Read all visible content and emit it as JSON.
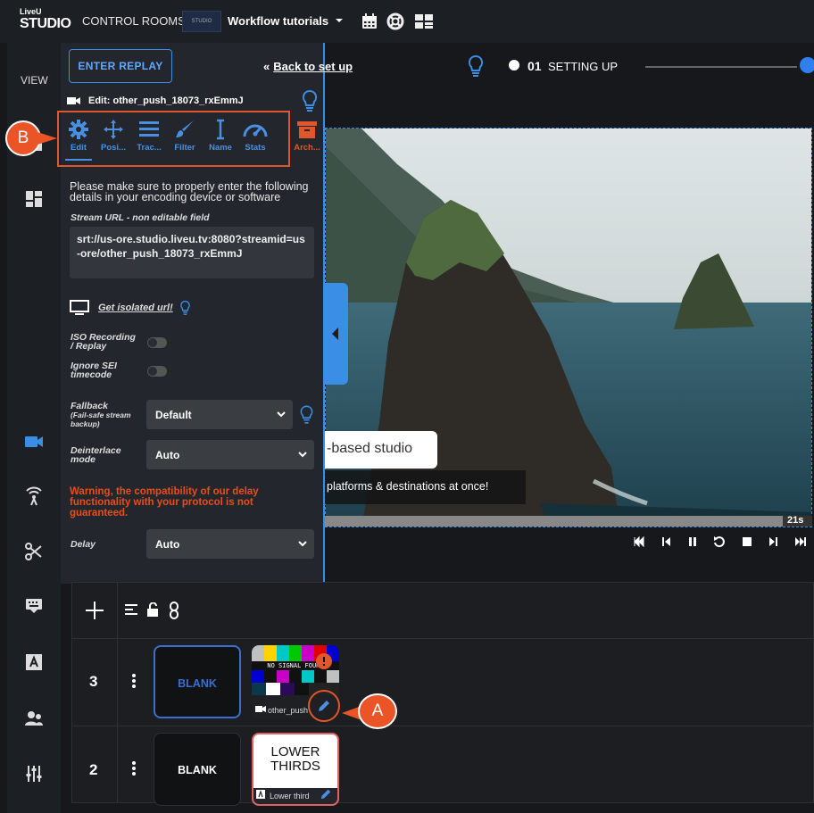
{
  "app": {
    "logo_line1": "LiveU",
    "logo_line2": "STUDIO",
    "nav_control_rooms": "CONTROL ROOMS",
    "room_thumb": "STUDIO",
    "workflow_title": "Workflow tutorials"
  },
  "sidebar": {
    "view_label": "VIEW"
  },
  "panel": {
    "enter_replay": "ENTER REPLAY",
    "edit_header": "Edit: other_push_18073_rxEmmJ",
    "tools": [
      {
        "label": "Edit",
        "icon": "gear-icon"
      },
      {
        "label": "Posi...",
        "icon": "move-icon"
      },
      {
        "label": "Trac...",
        "icon": "tracks-icon"
      },
      {
        "label": "Filter",
        "icon": "brush-icon"
      },
      {
        "label": "Name",
        "icon": "text-cursor-icon"
      },
      {
        "label": "Stats",
        "icon": "gauge-icon"
      },
      {
        "label": "Arch...",
        "icon": "archive-icon"
      }
    ],
    "info_text": "Please make sure to properly enter the following details in your encoding device or software",
    "stream_label": "Stream URL - non editable field",
    "stream_url": "srt://us-ore.studio.liveu.tv:8080?streamid=us-ore/other_push_18073_rxEmmJ",
    "isolated_url": "Get isolated url!",
    "iso_label_1": "ISO Recording",
    "iso_label_2": "/ Replay",
    "iso_enabled": false,
    "sei_label_1": "Ignore SEI",
    "sei_label_2": "timecode",
    "sei_enabled": false,
    "fallback_label": "Fallback",
    "fallback_sub_1": "(Fail-safe stream",
    "fallback_sub_2": "backup)",
    "fallback_value": "Default",
    "deinterlace_label_1": "Deinterlace",
    "deinterlace_label_2": "mode",
    "deinterlace_value": "Auto",
    "warning": "Warning, the compatibility of our delay functionality with your protocol is not guaranteed.",
    "delay_label": "Delay",
    "delay_value": "Auto"
  },
  "preview": {
    "back_arrow": "«",
    "back_link": "Back to set up",
    "step_number": "01",
    "step_name": "SETTING UP",
    "banner_text": "-based studio",
    "banner_sub": "platforms & destinations at once!",
    "time_remaining": "21s",
    "progress": 0.94
  },
  "layers": {
    "rows": [
      {
        "number": "3",
        "blank_label": "BLANK",
        "card_caption": "other_push",
        "card_label": "NO SIGNAL FOUND"
      },
      {
        "number": "2",
        "blank_label": "BLANK",
        "card_title_1": "LOWER",
        "card_title_2": "THIRDS",
        "card_caption": "Lower third"
      }
    ]
  },
  "callouts": {
    "a": "A",
    "b": "B"
  },
  "colors": {
    "accent": "#3a8ee6",
    "callout": "#ea5427",
    "warning": "#e84e1b",
    "panel_bg": "#23262c"
  }
}
